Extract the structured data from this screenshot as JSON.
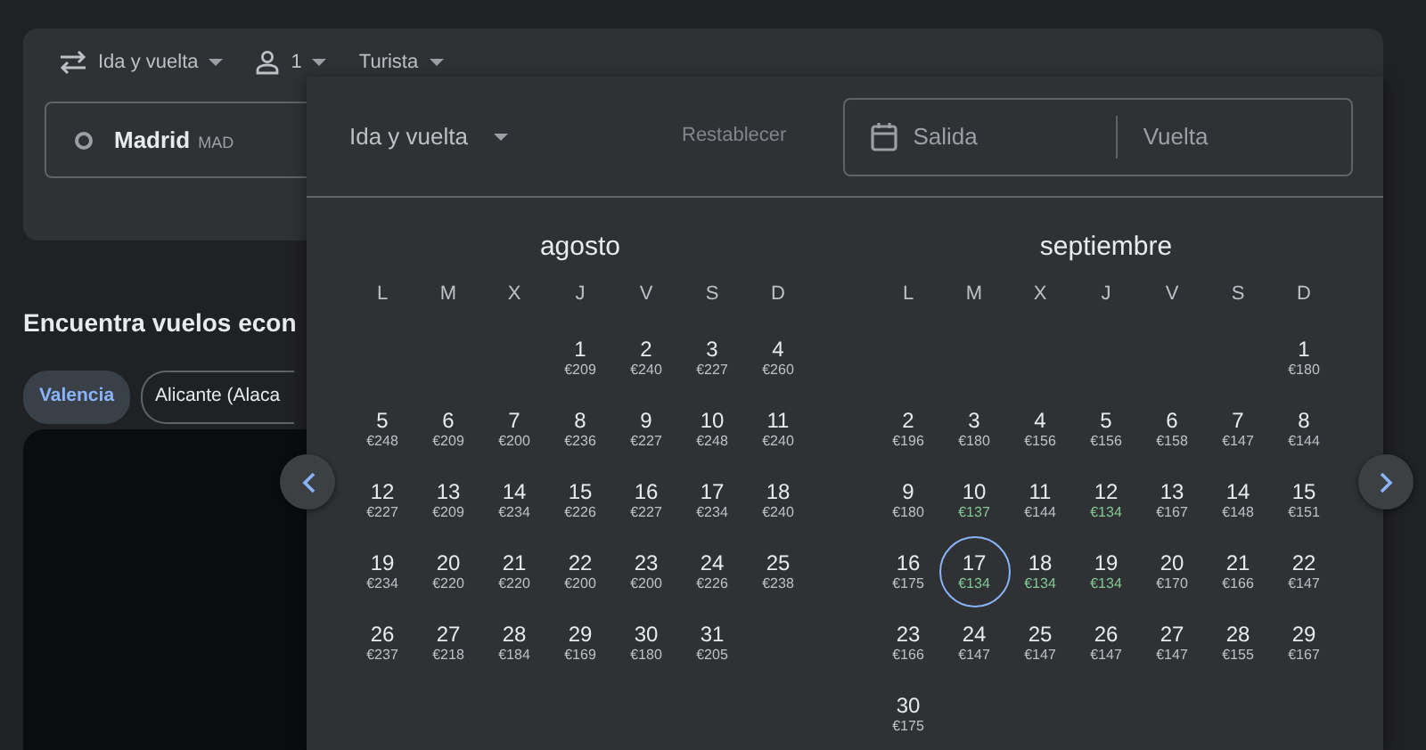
{
  "search_card": {
    "trip_type": "Ida y vuelta",
    "passengers": "1",
    "cabin": "Turista",
    "origin": {
      "city": "Madrid",
      "code": "MAD"
    }
  },
  "section": {
    "heading": "Encuentra vuelos econ",
    "chips": [
      {
        "label": "Valencia",
        "selected": true
      },
      {
        "label": "Alicante (Alaca",
        "selected": false
      }
    ]
  },
  "date_picker": {
    "trip_type": "Ida y vuelta",
    "reset": "Restablecer",
    "departure_placeholder": "Salida",
    "return_placeholder": "Vuelta",
    "months": [
      {
        "name": "agosto",
        "weekdays": [
          "L",
          "M",
          "X",
          "J",
          "V",
          "S",
          "D"
        ],
        "days": [
          {
            "kind": "blank"
          },
          {
            "kind": "blank"
          },
          {
            "kind": "blank"
          },
          {
            "kind": "date",
            "day": "1",
            "price": "€209",
            "cheap": false,
            "selected": false
          },
          {
            "kind": "date",
            "day": "2",
            "price": "€240",
            "cheap": false,
            "selected": false
          },
          {
            "kind": "date",
            "day": "3",
            "price": "€227",
            "cheap": false,
            "selected": false
          },
          {
            "kind": "date",
            "day": "4",
            "price": "€260",
            "cheap": false,
            "selected": false
          },
          {
            "kind": "date",
            "day": "5",
            "price": "€248",
            "cheap": false,
            "selected": false
          },
          {
            "kind": "date",
            "day": "6",
            "price": "€209",
            "cheap": false,
            "selected": false
          },
          {
            "kind": "date",
            "day": "7",
            "price": "€200",
            "cheap": false,
            "selected": false
          },
          {
            "kind": "date",
            "day": "8",
            "price": "€236",
            "cheap": false,
            "selected": false
          },
          {
            "kind": "date",
            "day": "9",
            "price": "€227",
            "cheap": false,
            "selected": false
          },
          {
            "kind": "date",
            "day": "10",
            "price": "€248",
            "cheap": false,
            "selected": false
          },
          {
            "kind": "date",
            "day": "11",
            "price": "€240",
            "cheap": false,
            "selected": false
          },
          {
            "kind": "date",
            "day": "12",
            "price": "€227",
            "cheap": false,
            "selected": false
          },
          {
            "kind": "date",
            "day": "13",
            "price": "€209",
            "cheap": false,
            "selected": false
          },
          {
            "kind": "date",
            "day": "14",
            "price": "€234",
            "cheap": false,
            "selected": false
          },
          {
            "kind": "date",
            "day": "15",
            "price": "€226",
            "cheap": false,
            "selected": false
          },
          {
            "kind": "date",
            "day": "16",
            "price": "€227",
            "cheap": false,
            "selected": false
          },
          {
            "kind": "date",
            "day": "17",
            "price": "€234",
            "cheap": false,
            "selected": false
          },
          {
            "kind": "date",
            "day": "18",
            "price": "€240",
            "cheap": false,
            "selected": false
          },
          {
            "kind": "date",
            "day": "19",
            "price": "€234",
            "cheap": false,
            "selected": false
          },
          {
            "kind": "date",
            "day": "20",
            "price": "€220",
            "cheap": false,
            "selected": false
          },
          {
            "kind": "date",
            "day": "21",
            "price": "€220",
            "cheap": false,
            "selected": false
          },
          {
            "kind": "date",
            "day": "22",
            "price": "€200",
            "cheap": false,
            "selected": false
          },
          {
            "kind": "date",
            "day": "23",
            "price": "€200",
            "cheap": false,
            "selected": false
          },
          {
            "kind": "date",
            "day": "24",
            "price": "€226",
            "cheap": false,
            "selected": false
          },
          {
            "kind": "date",
            "day": "25",
            "price": "€238",
            "cheap": false,
            "selected": false
          },
          {
            "kind": "date",
            "day": "26",
            "price": "€237",
            "cheap": false,
            "selected": false
          },
          {
            "kind": "date",
            "day": "27",
            "price": "€218",
            "cheap": false,
            "selected": false
          },
          {
            "kind": "date",
            "day": "28",
            "price": "€184",
            "cheap": false,
            "selected": false
          },
          {
            "kind": "date",
            "day": "29",
            "price": "€169",
            "cheap": false,
            "selected": false
          },
          {
            "kind": "date",
            "day": "30",
            "price": "€180",
            "cheap": false,
            "selected": false
          },
          {
            "kind": "date",
            "day": "31",
            "price": "€205",
            "cheap": false,
            "selected": false
          }
        ]
      },
      {
        "name": "septiembre",
        "weekdays": [
          "L",
          "M",
          "X",
          "J",
          "V",
          "S",
          "D"
        ],
        "days": [
          {
            "kind": "blank"
          },
          {
            "kind": "blank"
          },
          {
            "kind": "blank"
          },
          {
            "kind": "blank"
          },
          {
            "kind": "blank"
          },
          {
            "kind": "blank"
          },
          {
            "kind": "date",
            "day": "1",
            "price": "€180",
            "cheap": false,
            "selected": false
          },
          {
            "kind": "date",
            "day": "2",
            "price": "€196",
            "cheap": false,
            "selected": false
          },
          {
            "kind": "date",
            "day": "3",
            "price": "€180",
            "cheap": false,
            "selected": false
          },
          {
            "kind": "date",
            "day": "4",
            "price": "€156",
            "cheap": false,
            "selected": false
          },
          {
            "kind": "date",
            "day": "5",
            "price": "€156",
            "cheap": false,
            "selected": false
          },
          {
            "kind": "date",
            "day": "6",
            "price": "€158",
            "cheap": false,
            "selected": false
          },
          {
            "kind": "date",
            "day": "7",
            "price": "€147",
            "cheap": false,
            "selected": false
          },
          {
            "kind": "date",
            "day": "8",
            "price": "€144",
            "cheap": false,
            "selected": false
          },
          {
            "kind": "date",
            "day": "9",
            "price": "€180",
            "cheap": false,
            "selected": false
          },
          {
            "kind": "date",
            "day": "10",
            "price": "€137",
            "cheap": true,
            "selected": false
          },
          {
            "kind": "date",
            "day": "11",
            "price": "€144",
            "cheap": false,
            "selected": false
          },
          {
            "kind": "date",
            "day": "12",
            "price": "€134",
            "cheap": true,
            "selected": false
          },
          {
            "kind": "date",
            "day": "13",
            "price": "€167",
            "cheap": false,
            "selected": false
          },
          {
            "kind": "date",
            "day": "14",
            "price": "€148",
            "cheap": false,
            "selected": false
          },
          {
            "kind": "date",
            "day": "15",
            "price": "€151",
            "cheap": false,
            "selected": false
          },
          {
            "kind": "date",
            "day": "16",
            "price": "€175",
            "cheap": false,
            "selected": false
          },
          {
            "kind": "date",
            "day": "17",
            "price": "€134",
            "cheap": true,
            "selected": true
          },
          {
            "kind": "date",
            "day": "18",
            "price": "€134",
            "cheap": true,
            "selected": false
          },
          {
            "kind": "date",
            "day": "19",
            "price": "€134",
            "cheap": true,
            "selected": false
          },
          {
            "kind": "date",
            "day": "20",
            "price": "€170",
            "cheap": false,
            "selected": false
          },
          {
            "kind": "date",
            "day": "21",
            "price": "€166",
            "cheap": false,
            "selected": false
          },
          {
            "kind": "date",
            "day": "22",
            "price": "€147",
            "cheap": false,
            "selected": false
          },
          {
            "kind": "date",
            "day": "23",
            "price": "€166",
            "cheap": false,
            "selected": false
          },
          {
            "kind": "date",
            "day": "24",
            "price": "€147",
            "cheap": false,
            "selected": false
          },
          {
            "kind": "date",
            "day": "25",
            "price": "€147",
            "cheap": false,
            "selected": false
          },
          {
            "kind": "date",
            "day": "26",
            "price": "€147",
            "cheap": false,
            "selected": false
          },
          {
            "kind": "date",
            "day": "27",
            "price": "€147",
            "cheap": false,
            "selected": false
          },
          {
            "kind": "date",
            "day": "28",
            "price": "€155",
            "cheap": false,
            "selected": false
          },
          {
            "kind": "date",
            "day": "29",
            "price": "€167",
            "cheap": false,
            "selected": false
          },
          {
            "kind": "date",
            "day": "30",
            "price": "€175",
            "cheap": false,
            "selected": false
          }
        ]
      }
    ]
  }
}
